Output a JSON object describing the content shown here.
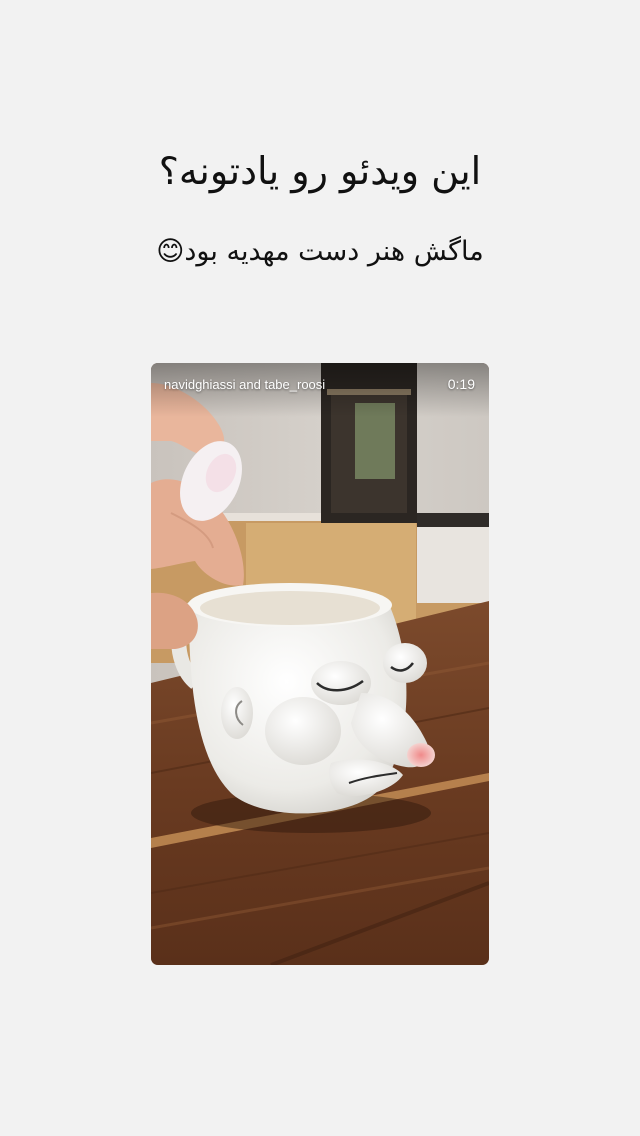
{
  "story": {
    "headline": "این ویدئو رو یادتونه؟",
    "caption": "ماگش هنر  دست مهدیه بود😊"
  },
  "video": {
    "credit": "navidghiassi and tabe_roosi",
    "duration": "0:19"
  }
}
